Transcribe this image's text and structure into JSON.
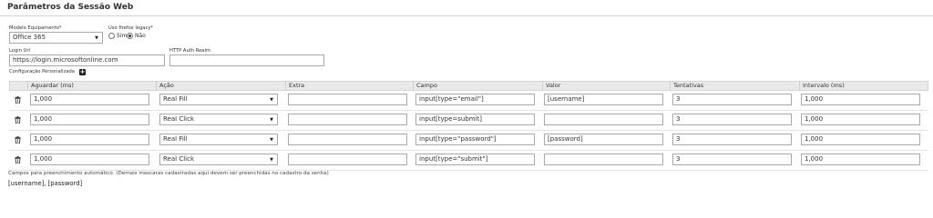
{
  "page": {
    "title": "Parâmetros da Sessão Web"
  },
  "form": {
    "equipment_label": "Modelo Equipamento*",
    "equipment_value": "Office 365",
    "firefox_label": "Uso firefox legacy*",
    "radio_yes": "Sim",
    "radio_no": "Não",
    "radio_selected": "Não",
    "login_url_label": "Login Url",
    "login_url_value": "https://login.microsoftonline.com",
    "http_auth_label": "HTTP Auth Realm",
    "http_auth_value": "",
    "custom_config_label": "Configuração Personalizada"
  },
  "table": {
    "headers": [
      "Aguardar (ms)",
      "Ação",
      "Extra",
      "Campo",
      "Valor",
      "Tentativas",
      "Intervalo (ms)"
    ],
    "rows": [
      {
        "wait": "1,000",
        "action": "Real Fill",
        "extra": "",
        "field": "input[type=\"email\"]",
        "value": "[username]",
        "attempts": "3",
        "interval": "1,000"
      },
      {
        "wait": "1,000",
        "action": "Real Click",
        "extra": "",
        "field": "input[type=submit]",
        "value": "",
        "attempts": "3",
        "interval": "1,000"
      },
      {
        "wait": "1,000",
        "action": "Real Fill",
        "extra": "",
        "field": "input[type=\"password\"]",
        "value": "[password]",
        "attempts": "3",
        "interval": "1,000"
      },
      {
        "wait": "1,000",
        "action": "Real Click",
        "extra": "",
        "field": "input[type=\"submit\"]",
        "value": "",
        "attempts": "3",
        "interval": "1,000"
      }
    ]
  },
  "footer": {
    "note": "Campos para preenchimento automático. (Demais mascaras cadastradas aqui devem ser preenchidas no cadastro da senha)",
    "variables": "[username], [password]"
  }
}
